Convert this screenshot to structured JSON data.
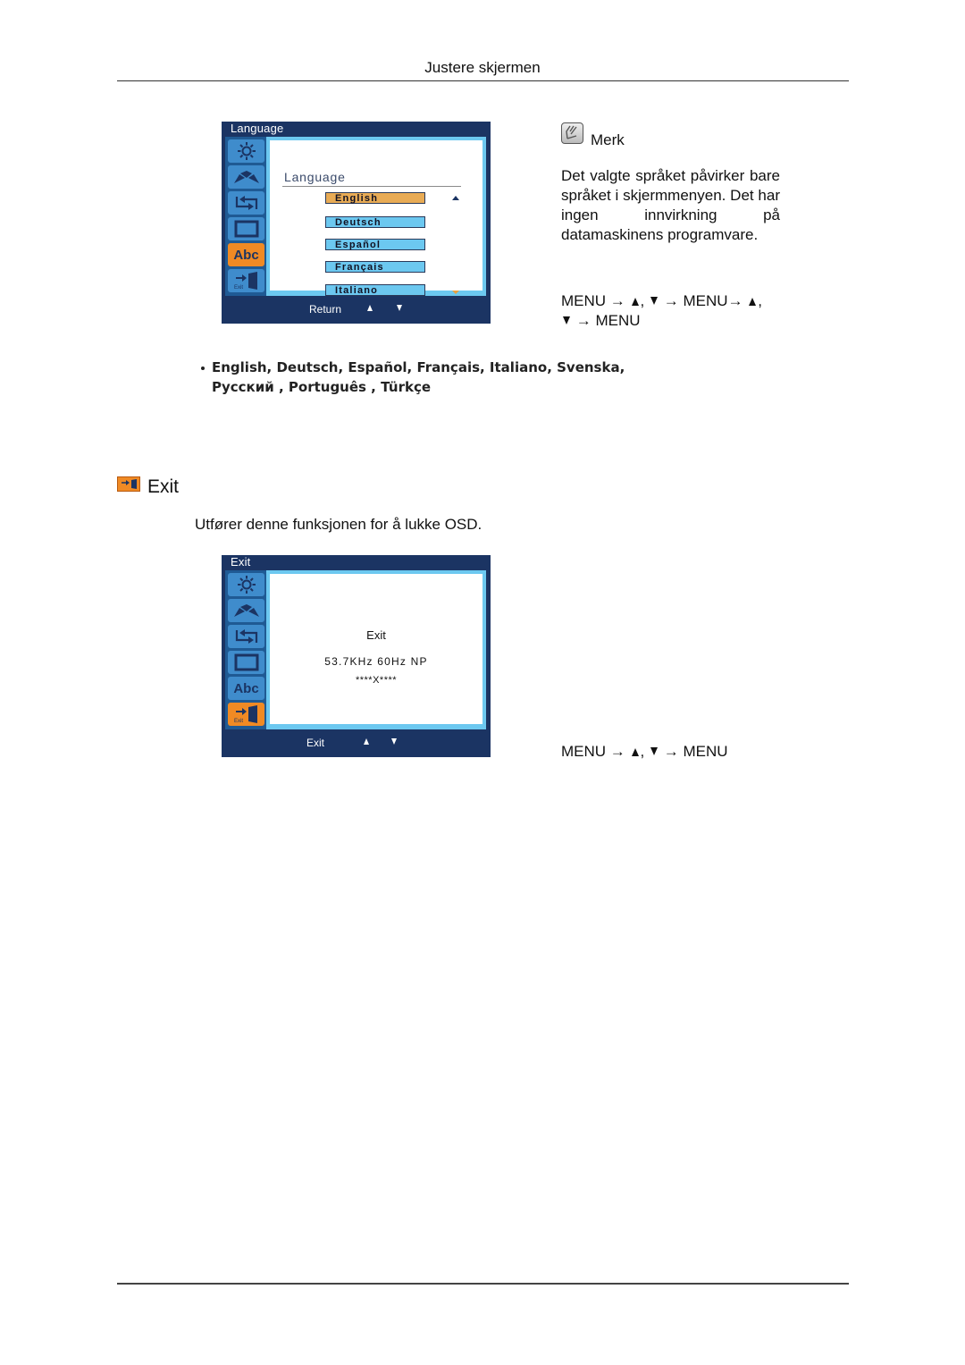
{
  "header": {
    "title": "Justere skjermen"
  },
  "language_osd": {
    "title": "Language",
    "heading": "Language",
    "sidebar_icons": [
      "brightness-icon",
      "color-icon",
      "image-setup-icon",
      "size-position-icon",
      "language-icon",
      "exit-icon"
    ],
    "active_icon": "language-icon",
    "options": [
      {
        "label": "English",
        "selected": true
      },
      {
        "label": "Deutsch",
        "selected": false
      },
      {
        "label": "Español",
        "selected": false
      },
      {
        "label": "Français",
        "selected": false
      },
      {
        "label": "Italiano",
        "selected": false
      }
    ],
    "bottom_label": "Return",
    "icon_abc_label": "Abc",
    "icon_exit_label": "Exit"
  },
  "note": {
    "title": "Merk",
    "body": "Det valgte språket påvirker bare språket i skjermmenyen. Det har ingen innvirkning på datamaskinens programvare."
  },
  "language_menu_path": {
    "menu": "MENU",
    "arrow": "→",
    "comma": ","
  },
  "language_list": {
    "line1": "English, Deutsch, Español, Français,  Italiano, Svenska,",
    "line2": "Русский , Português , Türkçe"
  },
  "exit_section": {
    "title": "Exit",
    "description": "Utfører denne funksjonen for å lukke OSD."
  },
  "exit_osd": {
    "title": "Exit",
    "content_title": "Exit",
    "frequency": "53.7KHz 60Hz NP",
    "position": "****X****",
    "bottom_label": "Exit",
    "active_icon": "exit-icon",
    "icon_abc_label": "Abc",
    "icon_exit_label": "Exit"
  },
  "exit_menu_path": {
    "menu": "MENU",
    "arrow": "→",
    "comma": ","
  },
  "colors": {
    "osd_background": "#1b3463",
    "osd_sidebar": "#1f5a94",
    "osd_icon": "#3f8ccc",
    "osd_icon_active": "#f08a24",
    "osd_frame": "#6cc8f0",
    "option_selected": "#e8ab55",
    "option_default": "#6cc8f0"
  }
}
